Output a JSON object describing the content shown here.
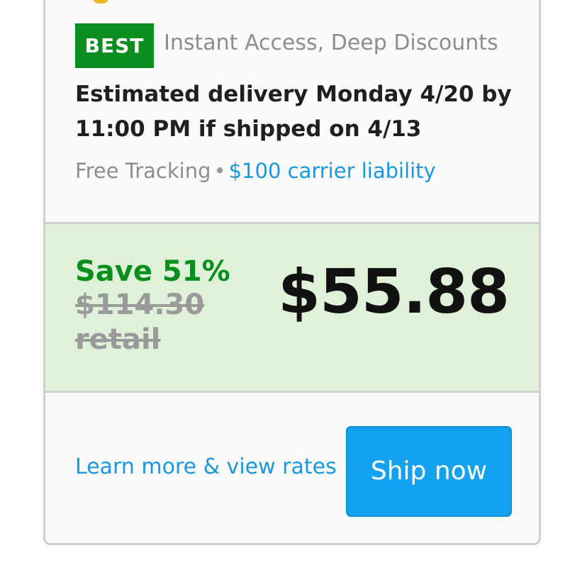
{
  "option": {
    "badge": "BEST",
    "badge_description": "Instant Access, Deep Discounts",
    "delivery_line": "Estimated delivery Monday 4/20 by 11:00 PM if shipped on 4/13",
    "tracking": "Free Tracking",
    "separator": "•",
    "liability": "$100 carrier liability"
  },
  "pricing": {
    "save": "Save 51%",
    "retail": "$114.30 retail",
    "price": "$55.88"
  },
  "actions": {
    "learn_more": "Learn more & view rates",
    "ship_now": "Ship now"
  },
  "colors": {
    "badge_green": "#0a8f1e",
    "price_bg": "#dff1d8",
    "link_blue": "#1b97df",
    "button_blue": "#13a2ef"
  }
}
